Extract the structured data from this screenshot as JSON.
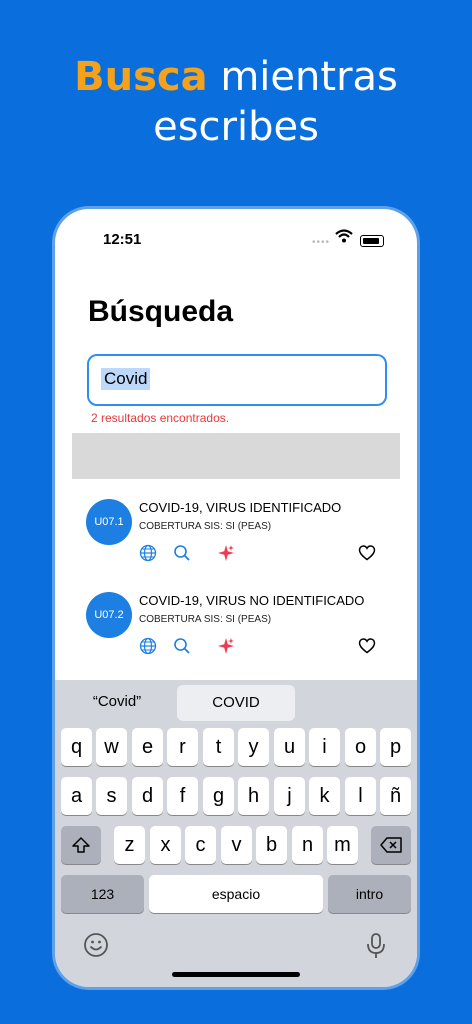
{
  "headline": {
    "accent": "Busca",
    "rest_line1": " mientras",
    "line2": "escribes"
  },
  "status_bar": {
    "time": "12:51"
  },
  "screen": {
    "title": "Búsqueda",
    "search": {
      "value": "Covid"
    },
    "results_count": "2 resultados encontrados.",
    "results": [
      {
        "code": "U07.1",
        "name": "COVID-19, VIRUS IDENTIFICADO",
        "coverage": "COBERTURA SIS: SI (PEAS)"
      },
      {
        "code": "U07.2",
        "name": "COVID-19, VIRUS NO IDENTIFICADO",
        "coverage": "COBERTURA SIS: SI (PEAS)"
      }
    ]
  },
  "keyboard": {
    "suggestions": [
      "“Covid”",
      "COVID",
      ""
    ],
    "row1": [
      "q",
      "w",
      "e",
      "r",
      "t",
      "y",
      "u",
      "i",
      "o",
      "p"
    ],
    "row2": [
      "a",
      "s",
      "d",
      "f",
      "g",
      "h",
      "j",
      "k",
      "l",
      "ñ"
    ],
    "row3": [
      "z",
      "x",
      "c",
      "v",
      "b",
      "n",
      "m"
    ],
    "numbers_key": "123",
    "space_key": "espacio",
    "return_key": "intro"
  },
  "colors": {
    "background": "#0a6fdd",
    "accent": "#f4a21b",
    "primary": "#1e7fe3",
    "error": "#e63a3a"
  }
}
